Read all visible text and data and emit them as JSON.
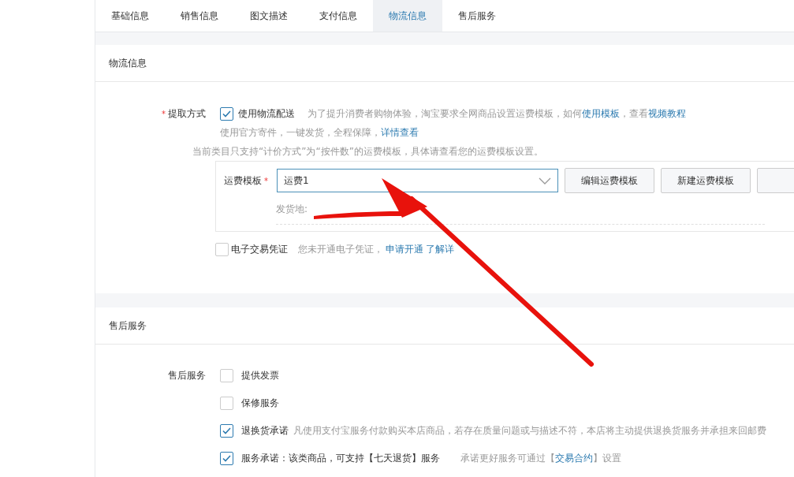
{
  "tabs": [
    {
      "label": "基础信息",
      "selected": false
    },
    {
      "label": "销售信息",
      "selected": false
    },
    {
      "label": "图文描述",
      "selected": false
    },
    {
      "label": "支付信息",
      "selected": false
    },
    {
      "label": "物流信息",
      "selected": true
    },
    {
      "label": "售后服务",
      "selected": false
    }
  ],
  "logistics": {
    "title": "物流信息",
    "pickup": {
      "label": "提取方式",
      "required_mark": "*",
      "option": "使用物流配送",
      "checked": true,
      "note": "为了提升消费者购物体验，淘宝要求全网商品设置运费模板，如何",
      "note_link": "使用模板",
      "note_mid": "，查看",
      "note_link2": "视频教程"
    },
    "official": {
      "text": "使用官方寄件，一键发货，全程保障，",
      "link": "详情查看"
    },
    "hint": "当前类目只支持“计价方式”为“按件数”的运费模板，具体请查看您的运费模板设置。",
    "template": {
      "label": "运费模板",
      "required_mark": "*",
      "value": "运费1",
      "buttons": [
        "编辑运费模板",
        "新建运费模板"
      ],
      "origin_label": "发货地:"
    },
    "voucher": {
      "label": "电子交易凭证",
      "checked": false,
      "note": "您未开通电子凭证，",
      "links": [
        "申请开通",
        "了解详"
      ]
    }
  },
  "after_sales": {
    "title": "售后服务",
    "label": "售后服务",
    "options": [
      {
        "label": "提供发票",
        "checked": false
      },
      {
        "label": "保修服务",
        "checked": false
      },
      {
        "label": "退换货承诺",
        "checked": true,
        "note": "凡使用支付宝服务付款购买本店商品，若存在质量问题或与描述不符，本店将主动提供退换货服务并承担来回邮费"
      },
      {
        "label": "服务承诺：该类商品，可支持【七天退货】服务",
        "checked": true,
        "note": "承诺更好服务可通过【",
        "link": "交易合约",
        "note_end": "】设置"
      }
    ]
  }
}
